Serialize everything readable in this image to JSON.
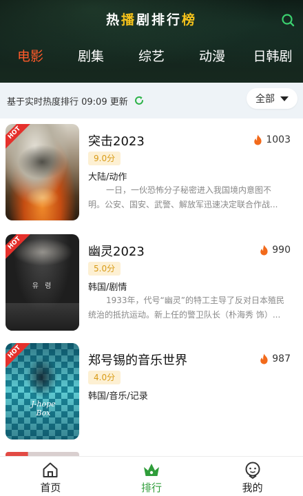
{
  "header": {
    "title_parts": [
      "热",
      "播",
      "剧",
      "排",
      "行",
      "榜"
    ],
    "search_icon": "search-icon"
  },
  "tabs": [
    {
      "label": "电影",
      "active": true
    },
    {
      "label": "剧集",
      "active": false
    },
    {
      "label": "综艺",
      "active": false
    },
    {
      "label": "动漫",
      "active": false
    },
    {
      "label": "日韩剧",
      "active": false
    }
  ],
  "subbar": {
    "info": "基于实时热度排行 09:09 更新",
    "refresh_icon": "refresh-icon"
  },
  "filter": {
    "selected": "全部"
  },
  "items": [
    {
      "badge": "HOT",
      "name": "突击2023",
      "heat": "1003",
      "score": "9.0分",
      "genre": "大陆/动作",
      "desc": "一日，一伙恐怖分子秘密进入我国境内意图不明。公安、国安、武警、解放军迅速决定联合作战..."
    },
    {
      "badge": "HOT",
      "name": "幽灵2023",
      "heat": "990",
      "score": "5.0分",
      "genre": "韩国/剧情",
      "desc": "1933年，代号“幽灵”的特工主导了反对日本殖民统治的抵抗运动。新上任的警卫队长（朴海秀 饰）..."
    },
    {
      "badge": "HOT",
      "name": "郑号锡的音乐世界",
      "heat": "987",
      "score": "4.0分",
      "genre": "韩国/音乐/记录",
      "desc": ""
    }
  ],
  "bottom_nav": [
    {
      "label": "首页",
      "icon": "home-icon",
      "active": false
    },
    {
      "label": "排行",
      "icon": "ranking-crown-icon",
      "active": true
    },
    {
      "label": "我的",
      "icon": "profile-icon",
      "active": false
    }
  ],
  "colors": {
    "tab_active": "#ff5a2a",
    "title_accent": "#f5c21b",
    "nav_active": "#2f9d3a",
    "score_text": "#d89b17",
    "heat_icon": "#f26a1b",
    "hot_badge": "#e5302b"
  }
}
